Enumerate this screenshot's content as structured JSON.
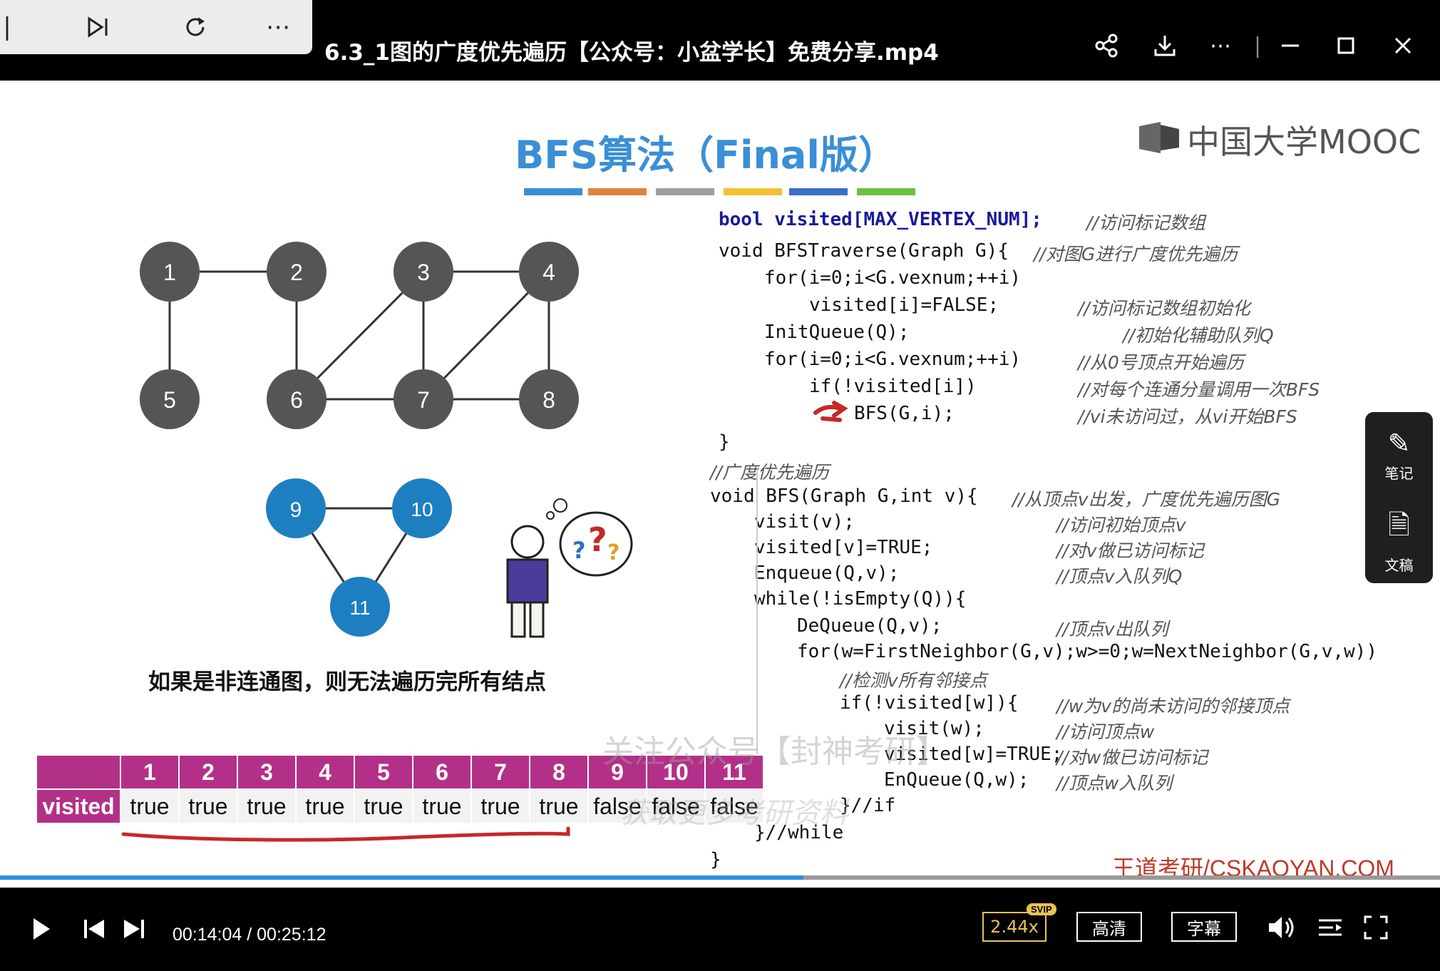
{
  "titlebar": {
    "title": "6.3_1图的广度优先遍历【公众号：小盆学长】免费分享.mp4"
  },
  "slide": {
    "title": "BFS算法（Final版）",
    "logo_text": "中国大学MOOC",
    "caption": "如果是非连通图，则无法遍历完所有结点",
    "brand": "王道考研/CSKAOYAN.COM",
    "watermark_line1": "关注公众号【封神考研】",
    "watermark_line2": "获取更多考研资料",
    "color_bar_colors": [
      "#3a8fd6",
      "#e0823a",
      "#9e9e9e",
      "#f1c232",
      "#3a6fc4",
      "#6fbf40"
    ],
    "graph_nodes": [
      "1",
      "2",
      "3",
      "4",
      "5",
      "6",
      "7",
      "8",
      "9",
      "10",
      "11"
    ],
    "code": {
      "l1_code": "bool visited[MAX_VERTEX_NUM];",
      "l1_cmt": "//访问标记数组",
      "l2_code": "void BFSTraverse(Graph G){",
      "l2_cmt": "//对图G进行广度优先遍历",
      "l3_code": "for(i=0;i<G.vexnum;++i)",
      "l4_code": "visited[i]=FALSE;",
      "l4_cmt": "//访问标记数组初始化",
      "l5_code": "InitQueue(Q);",
      "l5_cmt": "//初始化辅助队列Q",
      "l6_code": "for(i=0;i<G.vexnum;++i)",
      "l6_cmt": "//从0号顶点开始遍历",
      "l7_code": "if(!visited[i])",
      "l7_cmt": "//对每个连通分量调用一次BFS",
      "l8_code": "BFS(G,i);",
      "l8_cmt": "//vi未访问过，从vi开始BFS",
      "l9_code": "}",
      "l10_cmt": "//广度优先遍历",
      "l11_code": "void BFS(Graph G,int v){",
      "l11_cmt": "//从顶点v出发，广度优先遍历图G",
      "l12_code": "visit(v);",
      "l12_cmt": "//访问初始顶点v",
      "l13_code": "visited[v]=TRUE;",
      "l13_cmt": "//对v做已访问标记",
      "l14_code": "Enqueue(Q,v);",
      "l14_cmt": "//顶点v入队列Q",
      "l15_code": "while(!isEmpty(Q)){",
      "l16_code": "DeQueue(Q,v);",
      "l16_cmt": "//顶点v出队列",
      "l17_code": "for(w=FirstNeighbor(G,v);w>=0;w=NextNeighbor(G,v,w))",
      "l18_cmt": "//检测v所有邻接点",
      "l19_code": "if(!visited[w]){",
      "l19_cmt": "//w为v的尚未访问的邻接顶点",
      "l20_code": "visit(w);",
      "l20_cmt": "//访问顶点w",
      "l21_code": "visited[w]=TRUE;",
      "l21_cmt": "//对w做已访问标记",
      "l22_code": "EnQueue(Q,w);",
      "l22_cmt": "//顶点w入队列",
      "l23_code": "}//if",
      "l24_code": "}//while",
      "l25_code": "}"
    },
    "visited_table": {
      "label": "visited",
      "headers": [
        "1",
        "2",
        "3",
        "4",
        "5",
        "6",
        "7",
        "8",
        "9",
        "10",
        "11"
      ],
      "values": [
        "true",
        "true",
        "true",
        "true",
        "true",
        "true",
        "true",
        "true",
        "false",
        "false",
        "false"
      ]
    }
  },
  "side_panel": {
    "notes_label": "笔记",
    "doc_label": "文稿"
  },
  "player": {
    "current_time": "00:14:04",
    "total_time": "00:25:12",
    "time_display": "00:14:04 / 00:25:12",
    "progress_fraction": 0.558,
    "speed": "2.44x",
    "speed_badge": "SVIP",
    "quality": "高清",
    "subtitle": "字幕"
  }
}
